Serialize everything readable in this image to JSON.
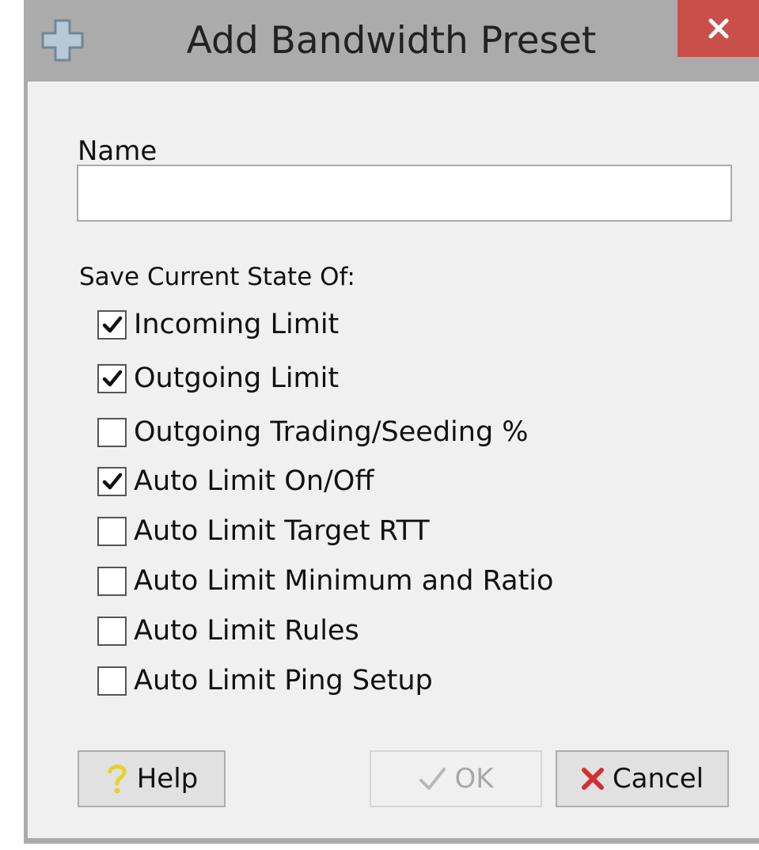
{
  "dialog": {
    "title": "Add Bandwidth Preset",
    "title_icon": "add-plus-icon",
    "close_icon": "close-icon"
  },
  "name_field": {
    "label": "Name",
    "value": "",
    "placeholder": ""
  },
  "save_section": {
    "label": "Save Current State Of:",
    "options": [
      {
        "label": "Incoming Limit",
        "checked": true
      },
      {
        "label": "Outgoing Limit",
        "checked": true
      },
      {
        "label": "Outgoing Trading/Seeding %",
        "checked": false
      },
      {
        "label": "Auto Limit On/Off",
        "checked": true
      },
      {
        "label": "Auto Limit Target RTT",
        "checked": false
      },
      {
        "label": "Auto Limit Minimum and Ratio",
        "checked": false
      },
      {
        "label": "Auto Limit Rules",
        "checked": false
      },
      {
        "label": "Auto Limit Ping Setup",
        "checked": false
      }
    ]
  },
  "buttons": {
    "help_label": "Help",
    "help_icon": "question-mark-icon",
    "ok_label": "OK",
    "ok_icon": "checkmark-icon",
    "ok_enabled": false,
    "cancel_label": "Cancel",
    "cancel_icon": "x-mark-icon"
  },
  "colors": {
    "frame": "#ababab",
    "close_button": "#c9504a",
    "dialog_body": "#f0f0f0",
    "cancel_icon": "#d32f2f",
    "help_icon": "#e6d22c"
  }
}
